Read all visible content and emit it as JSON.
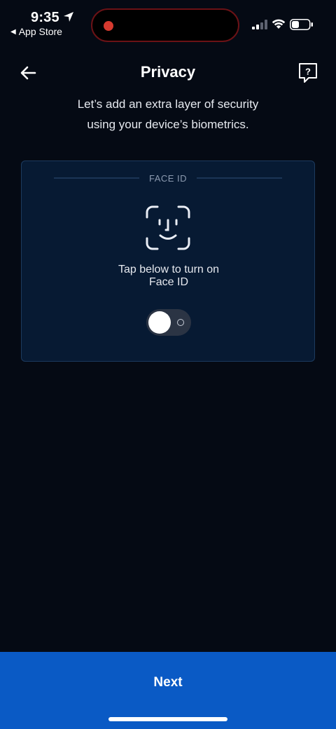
{
  "status_bar": {
    "time": "9:35",
    "back_app": "App Store",
    "back_arrow_glyph": "◀"
  },
  "header": {
    "title": "Privacy",
    "back_icon": "arrow-left-icon",
    "help_icon": "help-bubble-icon",
    "help_glyph": "?"
  },
  "subtitle": {
    "line1": "Let’s add an extra layer of security",
    "line2": "using your device’s biometrics."
  },
  "card": {
    "label": "FACE ID",
    "instruction_line1": "Tap below to turn on",
    "instruction_line2": "Face ID",
    "toggle_on": false
  },
  "footer": {
    "next_label": "Next"
  },
  "colors": {
    "background": "#050a14",
    "card_bg": "#071a33",
    "card_border": "#1c3a5e",
    "accent_blue": "#0a5ac5",
    "recording_red": "#d63a2f"
  }
}
